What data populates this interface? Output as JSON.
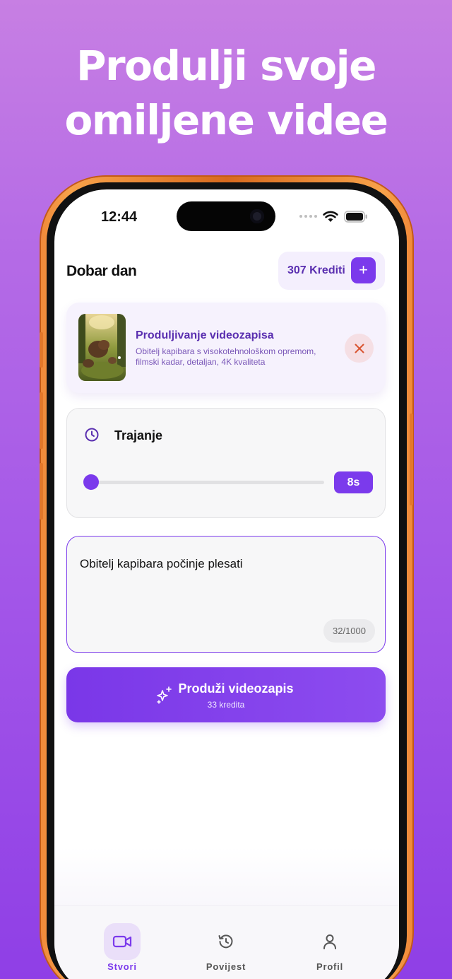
{
  "promo": {
    "headline_line1": "Produlji svoje",
    "headline_line2": "omiljene videe"
  },
  "status_bar": {
    "time": "12:44",
    "icons": [
      "signal-dots-icon",
      "wifi-icon",
      "battery-icon"
    ]
  },
  "header": {
    "greeting": "Dobar dan",
    "credits_label": "307 Krediti",
    "add_credits_symbol": "+"
  },
  "video_card": {
    "title": "Produljivanje videozapisa",
    "description": "Obitelj kapibara s visokotehnološkom opremom, filmski kadar, detaljan, 4K kvaliteta",
    "thumbnail": "capybara-family-thumbnail",
    "close_icon": "close-icon"
  },
  "duration": {
    "label": "Trajanje",
    "value_label": "8s",
    "slider_fraction": 0.0
  },
  "prompt": {
    "text": "Obitelj kapibara počinje plesati",
    "char_count": "32/1000"
  },
  "primary_action": {
    "label": "Produži videozapis",
    "sublabel": "33 kredita",
    "icon": "sparkles-icon"
  },
  "tabbar": {
    "tabs": [
      {
        "label": "Stvori",
        "icon": "video-camera-icon",
        "active": true
      },
      {
        "label": "Povijest",
        "icon": "history-icon",
        "active": false
      },
      {
        "label": "Profil",
        "icon": "user-icon",
        "active": false
      }
    ]
  },
  "colors": {
    "accent": "#7b3aec",
    "accent_text": "#5a2fb0",
    "background_gradient_top": "#c77fe3",
    "background_gradient_bottom": "#8f3fe6",
    "phone_frame": "#f08a3a",
    "close_icon": "#d9532e"
  }
}
